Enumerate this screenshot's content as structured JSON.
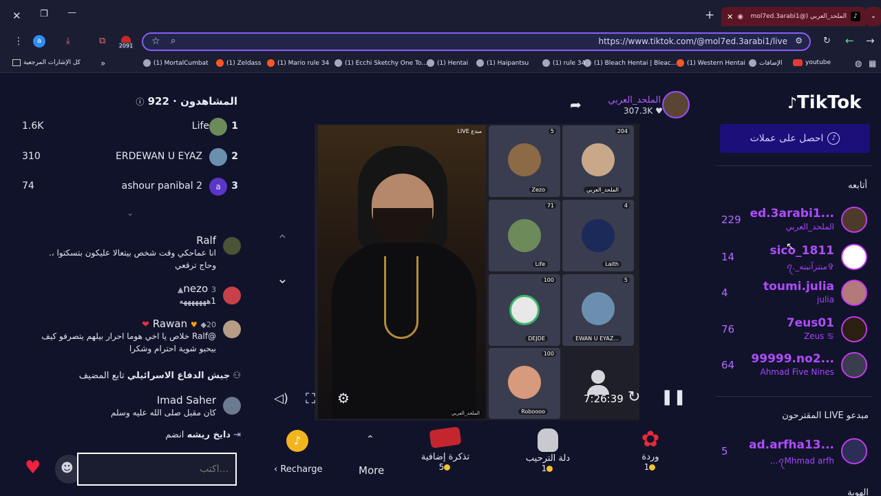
{
  "browser": {
    "tab_title": "الملحد_العربي (@mol7ed.3arabi1",
    "url": "https://www.tiktok.com/@mol7ed.3arabi1/live",
    "extension_badge": "2091",
    "profile_letter": "a",
    "bookmarks": [
      "youtube",
      "الإضافات",
      "(1) Western Hentai",
      "(1) Bleach Hentai | Bleac...",
      "(1) rule 34",
      "(1) Haipantsu",
      "(1) Hentai",
      "(1) Ecchi Sketchy One To...",
      "(1) Mario rule 34",
      "(1) Zeldass",
      "(1) MortalCumbat",
      "كل الإشارات المرجعية"
    ]
  },
  "right_sidebar": {
    "logo": "TikTok",
    "get_coins": "احصل على عملات",
    "following_title": "أتابعه",
    "following": [
      {
        "name": "ed.3arabi1...",
        "sub": "الملحد_العربي",
        "count": "229"
      },
      {
        "name": "sico_1811",
        "sub": "ꪖ._منتزآنبنه✞",
        "count": "14"
      },
      {
        "name": "toumi.julia",
        "sub": "julia",
        "count": "4"
      },
      {
        "name": "7eus01",
        "sub": "Zeus ♋",
        "count": "76"
      },
      {
        "name": "99999.no2...",
        "sub": "Ahmad Five Nines",
        "count": "64"
      }
    ],
    "suggested_title": "مبدعو LIVE المقترحون",
    "suggested": [
      {
        "name": "ad.arfha13...",
        "sub": "...ꪖMhmad arfh",
        "count": "5"
      }
    ],
    "more_title": "الهوية"
  },
  "stream": {
    "host_name": "الملحد_العربي",
    "host_likes": "307.3K",
    "live_badge": "مبدع LIVE",
    "host_tag": "الملحد_العربي",
    "timer": "7:26:39",
    "guests": [
      {
        "name": "Zezo",
        "count": "5"
      },
      {
        "name": "الملحد_العربي",
        "count": "204"
      },
      {
        "name": "Life",
        "count": "71"
      },
      {
        "name": "Laith",
        "count": "4"
      },
      {
        "name": "DEJDE",
        "count": "100"
      },
      {
        "name": "EWAN U EYAZ...",
        "count": "5"
      },
      {
        "name": "Roboooo",
        "count": "100"
      }
    ]
  },
  "gifts": [
    {
      "name": "وردة",
      "price": "1"
    },
    {
      "name": "دلة الترحيب",
      "price": "1"
    },
    {
      "name": "تذكرة إضافية",
      "price": "5"
    }
  ],
  "bottom_actions": {
    "more": "More",
    "recharge": "Recharge"
  },
  "viewers": {
    "title": "المشاهدون · 922",
    "top": [
      {
        "rank": "1",
        "name": "Life",
        "score": "1.6K"
      },
      {
        "rank": "2",
        "name": "ERDEWAN U EYAZ",
        "score": "310"
      },
      {
        "rank": "3",
        "name": "ashour panibal 2",
        "score": "74",
        "avatar_letter": "a"
      }
    ]
  },
  "chat": [
    {
      "name": "Ralf",
      "text": "انا عماحكي وقت شخص بيتعالا عليكون بتسكتوا ،. وحاج ترقعي"
    },
    {
      "name": "nezo",
      "level": "3",
      "text": "1هههههههه"
    },
    {
      "name": "Rawan",
      "level": "20",
      "text": "@Ralf خلاص يا اخي هوما احرار بيلهم يتصرفو كيف بيحبو شوية احترام وشكرا"
    },
    {
      "name": "جيش الدفاع الاسرائيلي",
      "action": "تابع المضيف"
    },
    {
      "name": "Imad Saher",
      "text": "كان مقبل صلى الله عليه وسلم"
    },
    {
      "name": "دايخ ريشه",
      "action": "انضم"
    }
  ],
  "comment_placeholder": "...اكتب"
}
